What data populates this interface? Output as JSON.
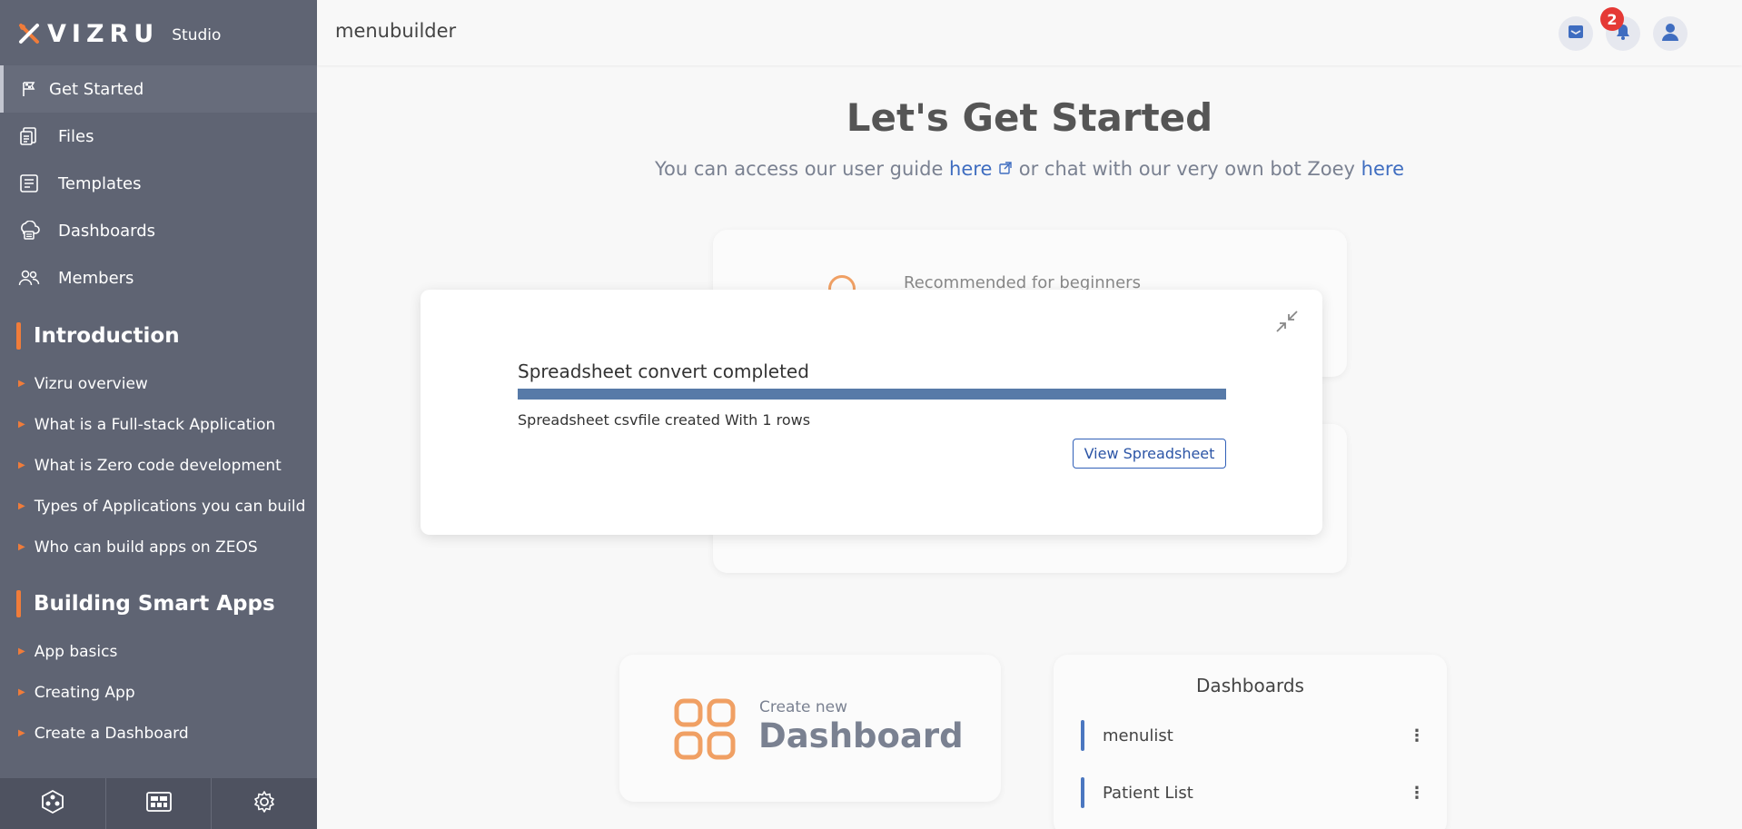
{
  "brand": {
    "name": "VIZRU",
    "product": "Studio"
  },
  "topbar": {
    "app_title": "menubuilder",
    "notification_count": "2"
  },
  "nav": [
    {
      "label": "Get Started",
      "icon": "flag-icon",
      "active": true
    },
    {
      "label": "Files",
      "icon": "files-icon"
    },
    {
      "label": "Templates",
      "icon": "templates-icon"
    },
    {
      "label": "Dashboards",
      "icon": "dashboard-cloud-icon"
    },
    {
      "label": "Members",
      "icon": "members-icon"
    }
  ],
  "sections": [
    {
      "title": "Introduction",
      "items": [
        "Vizru overview",
        "What is a Full-stack Application",
        "What is Zero code development",
        "Types of Applications you can build",
        "Who can build apps on ZEOS"
      ]
    },
    {
      "title": "Building Smart Apps",
      "items": [
        "App basics",
        "Creating App",
        "Create a Dashboard"
      ]
    }
  ],
  "main": {
    "headline": "Let's Get Started",
    "subline": {
      "prefix": "You can access our user guide ",
      "link1": "here",
      "middle": " or chat with our very own bot Zoey ",
      "link2": "here"
    },
    "recommended": "Recommended for beginners",
    "create": {
      "caption": "Create new",
      "title": "Dashboard"
    },
    "dashboards": {
      "title": "Dashboards",
      "items": [
        "menulist",
        "Patient List"
      ]
    }
  },
  "modal": {
    "title": "Spreadsheet convert completed",
    "progress_percent": 100,
    "message": "Spreadsheet csvfile created With 1 rows",
    "button": "View Spreadsheet"
  },
  "colors": {
    "sidebar": "#5f6473",
    "accent": "#f07c3a",
    "link": "#3f6dc0",
    "progress": "#577aa8"
  }
}
